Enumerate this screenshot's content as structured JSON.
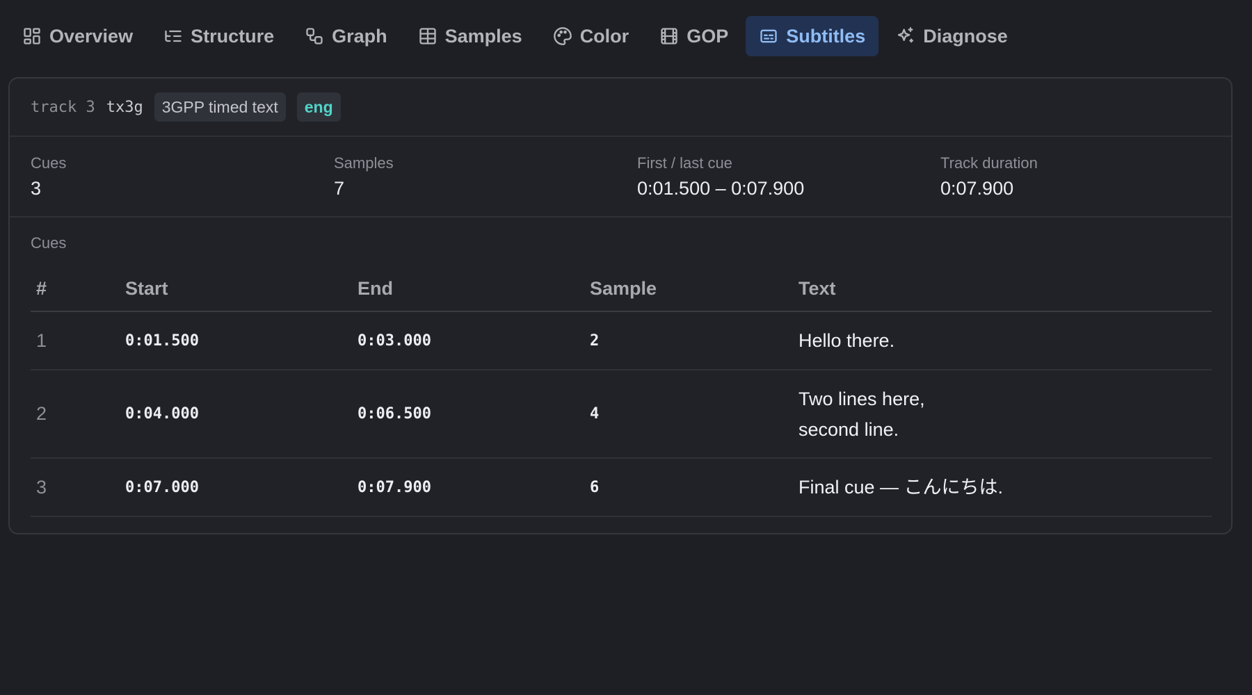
{
  "tabs": [
    {
      "label": "Overview",
      "icon": "grid-icon"
    },
    {
      "label": "Structure",
      "icon": "list-tree-icon"
    },
    {
      "label": "Graph",
      "icon": "graph-nodes-icon"
    },
    {
      "label": "Samples",
      "icon": "table-icon"
    },
    {
      "label": "Color",
      "icon": "palette-icon"
    },
    {
      "label": "GOP",
      "icon": "film-icon"
    },
    {
      "label": "Subtitles",
      "icon": "captions-icon",
      "active": true
    },
    {
      "label": "Diagnose",
      "icon": "sparkles-icon"
    }
  ],
  "track": {
    "id_label": "track 3",
    "codec": "tx3g",
    "type_badge": "3GPP timed text",
    "language_badge": "eng"
  },
  "stats": {
    "cues": {
      "label": "Cues",
      "value": "3"
    },
    "samples": {
      "label": "Samples",
      "value": "7"
    },
    "first_last": {
      "label": "First / last cue",
      "value": "0:01.500 – 0:07.900"
    },
    "duration": {
      "label": "Track duration",
      "value": "0:07.900"
    }
  },
  "cues_section_label": "Cues",
  "table": {
    "headers": [
      "#",
      "Start",
      "End",
      "Sample",
      "Text"
    ],
    "rows": [
      {
        "index": "1",
        "start": "0:01.500",
        "end": "0:03.000",
        "sample": "2",
        "text": "Hello there."
      },
      {
        "index": "2",
        "start": "0:04.000",
        "end": "0:06.500",
        "sample": "4",
        "text_line1": "Two lines here,",
        "text_line2": "second line."
      },
      {
        "index": "3",
        "start": "0:07.000",
        "end": "0:07.900",
        "sample": "6",
        "text": "Final cue — こんにちは."
      }
    ]
  },
  "colors": {
    "background": "#1e1f24",
    "active_tab_bg": "#223252",
    "active_tab_text": "#8fbcf5",
    "language_badge": "#4fd6c9"
  }
}
